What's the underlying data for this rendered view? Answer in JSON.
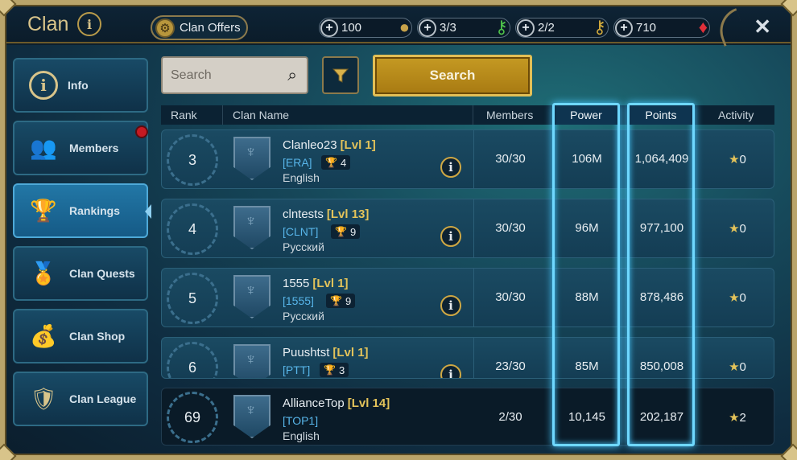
{
  "header": {
    "title": "Clan",
    "offers_label": "Clan Offers",
    "resources": [
      {
        "value": "100",
        "icon": "coin-icon"
      },
      {
        "value": "3/3",
        "icon": "green-key-icon"
      },
      {
        "value": "2/2",
        "icon": "gold-key-icon"
      },
      {
        "value": "710",
        "icon": "ruby-icon"
      }
    ]
  },
  "sidebar": {
    "items": [
      {
        "label": "Info",
        "icon": "info-icon"
      },
      {
        "label": "Members",
        "icon": "members-icon"
      },
      {
        "label": "Rankings",
        "icon": "trophy-icon"
      },
      {
        "label": "Clan Quests",
        "icon": "medal-icon"
      },
      {
        "label": "Clan Shop",
        "icon": "bag-icon"
      },
      {
        "label": "Clan League",
        "icon": "shield-stars-icon"
      }
    ]
  },
  "search": {
    "placeholder": "Search",
    "button_label": "Search"
  },
  "table": {
    "headers": {
      "rank": "Rank",
      "clan_name": "Clan Name",
      "members": "Members",
      "power": "Power",
      "points": "Points",
      "activity": "Activity"
    },
    "rows": [
      {
        "rank": "3",
        "name": "Clanleo23",
        "level": "[Lvl 1]",
        "tag": "[ERA]",
        "trophies": "4",
        "language": "English",
        "members": "30/30",
        "power": "106M",
        "points": "1,064,409",
        "activity": "0"
      },
      {
        "rank": "4",
        "name": "clntests",
        "level": "[Lvl 13]",
        "tag": "[CLNT]",
        "trophies": "9",
        "language": "Русский",
        "members": "30/30",
        "power": "96M",
        "points": "977,100",
        "activity": "0"
      },
      {
        "rank": "5",
        "name": "1555",
        "level": "[Lvl 1]",
        "tag": "[1555]",
        "trophies": "9",
        "language": "Русский",
        "members": "30/30",
        "power": "88M",
        "points": "878,486",
        "activity": "0"
      },
      {
        "rank": "6",
        "name": "Puushtst",
        "level": "[Lvl 1]",
        "tag": "[PTT]",
        "trophies": "3",
        "language": "",
        "members": "23/30",
        "power": "85M",
        "points": "850,008",
        "activity": "0"
      }
    ],
    "self_row": {
      "rank": "69",
      "name": "AllianceTop",
      "level": "[Lvl 14]",
      "tag": "[TOP1]",
      "language": "English",
      "members": "2/30",
      "power": "10,145",
      "points": "202,187",
      "activity": "2"
    }
  }
}
